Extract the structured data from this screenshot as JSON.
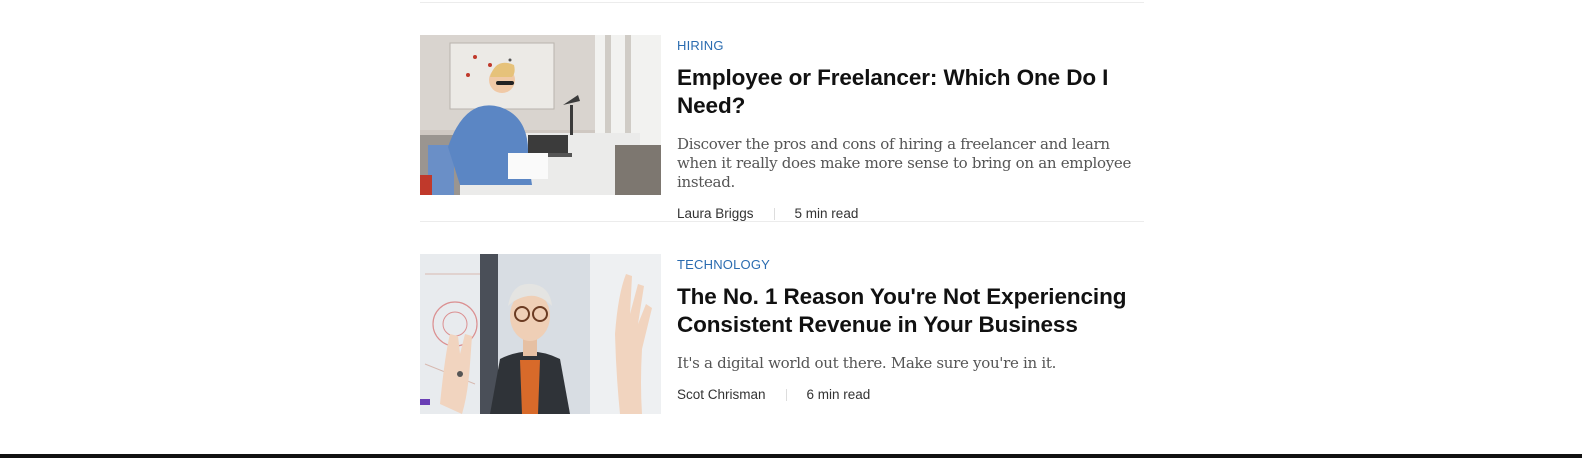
{
  "articles": [
    {
      "category": "HIRING",
      "title": "Employee or Freelancer: Which One Do I Need?",
      "description": "Discover the pros and cons of hiring a freelancer and learn when it really does make more sense to bring on an employee instead.",
      "author": "Laura Briggs",
      "read_time": "5 min read",
      "image_name": "woman-writing-at-desk-photo"
    },
    {
      "category": "TECHNOLOGY",
      "title": "The No. 1 Reason You're Not Experiencing Consistent Revenue in Your Business",
      "description": "It's a digital world out there. Make sure you're in it.",
      "author": "Scot Chrisman",
      "read_time": "6 min read",
      "image_name": "woman-touching-virtual-screen-photo"
    }
  ],
  "colors": {
    "category": "#2b6cb0",
    "title": "#111111",
    "description": "#555555",
    "bottom_bar": "#111111"
  }
}
